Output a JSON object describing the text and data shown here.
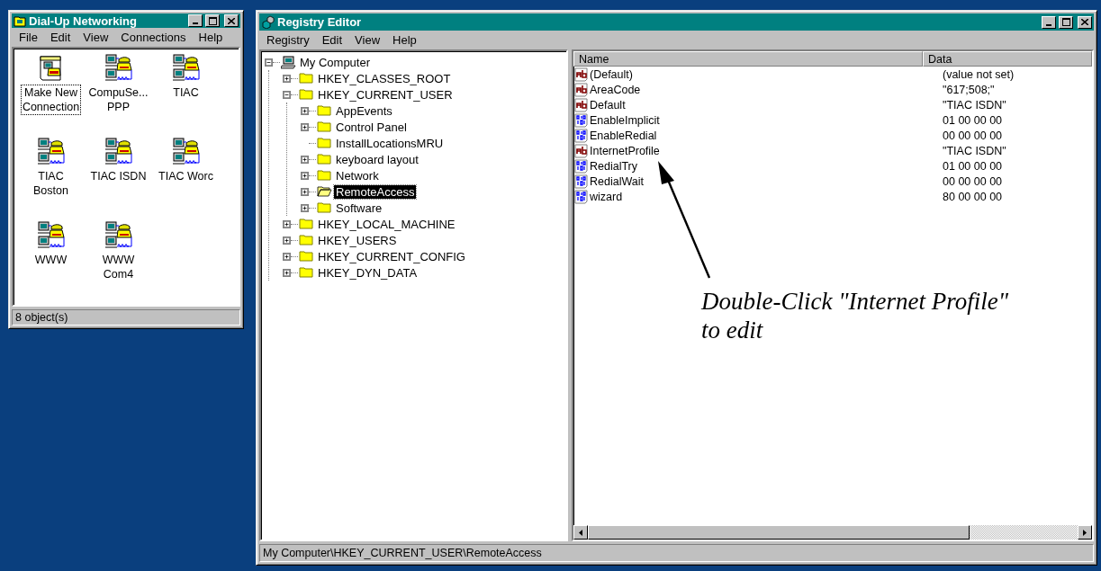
{
  "dialup_window": {
    "title": "Dial-Up Networking",
    "menu": [
      "File",
      "Edit",
      "View",
      "Connections",
      "Help"
    ],
    "icons": [
      {
        "kind": "new",
        "label_lines": [
          "Make New",
          "Connection"
        ],
        "focused": true
      },
      {
        "kind": "connection",
        "label_lines": [
          "CompuSe...",
          "PPP"
        ],
        "focused": false
      },
      {
        "kind": "connection",
        "label_lines": [
          "TIAC"
        ],
        "focused": false
      },
      {
        "kind": "connection",
        "label_lines": [
          "TIAC",
          "Boston"
        ],
        "focused": false
      },
      {
        "kind": "connection",
        "label_lines": [
          "TIAC ISDN"
        ],
        "focused": false
      },
      {
        "kind": "connection",
        "label_lines": [
          "TIAC Worc"
        ],
        "focused": false
      },
      {
        "kind": "connection",
        "label_lines": [
          "WWW"
        ],
        "focused": false
      },
      {
        "kind": "connection",
        "label_lines": [
          "WWW",
          "Com4"
        ],
        "focused": false
      }
    ],
    "status": "8 object(s)"
  },
  "registry_window": {
    "title": "Registry Editor",
    "menu": [
      "Registry",
      "Edit",
      "View",
      "Help"
    ],
    "tree": {
      "label": "My Computer",
      "kind": "computer",
      "expanded": true,
      "has_subkeys": true,
      "selected": false,
      "children": [
        {
          "label": "HKEY_CLASSES_ROOT",
          "expanded": false,
          "has_subkeys": true,
          "selected": false
        },
        {
          "label": "HKEY_CURRENT_USER",
          "expanded": true,
          "has_subkeys": true,
          "selected": false,
          "children": [
            {
              "label": "AppEvents",
              "expanded": false,
              "has_subkeys": true,
              "selected": false
            },
            {
              "label": "Control Panel",
              "expanded": false,
              "has_subkeys": true,
              "selected": false
            },
            {
              "label": "InstallLocationsMRU",
              "expanded": false,
              "has_subkeys": false,
              "selected": false
            },
            {
              "label": "keyboard layout",
              "expanded": false,
              "has_subkeys": true,
              "selected": false
            },
            {
              "label": "Network",
              "expanded": false,
              "has_subkeys": true,
              "selected": false
            },
            {
              "label": "RemoteAccess",
              "expanded": false,
              "has_subkeys": true,
              "selected": true
            },
            {
              "label": "Software",
              "expanded": false,
              "has_subkeys": true,
              "selected": false
            }
          ]
        },
        {
          "label": "HKEY_LOCAL_MACHINE",
          "expanded": false,
          "has_subkeys": true,
          "selected": false
        },
        {
          "label": "HKEY_USERS",
          "expanded": false,
          "has_subkeys": true,
          "selected": false
        },
        {
          "label": "HKEY_CURRENT_CONFIG",
          "expanded": false,
          "has_subkeys": true,
          "selected": false
        },
        {
          "label": "HKEY_DYN_DATA",
          "expanded": false,
          "has_subkeys": true,
          "selected": false
        }
      ]
    },
    "columns": [
      "Name",
      "Data"
    ],
    "values": [
      {
        "kind": "string",
        "name": "(Default)",
        "data": "(value not set)"
      },
      {
        "kind": "string",
        "name": "AreaCode",
        "data": "\"617;508;\""
      },
      {
        "kind": "string",
        "name": "Default",
        "data": "\"TIAC ISDN\""
      },
      {
        "kind": "binary",
        "name": "EnableImplicit",
        "data": "01 00 00 00"
      },
      {
        "kind": "binary",
        "name": "EnableRedial",
        "data": "00 00 00 00"
      },
      {
        "kind": "string",
        "name": "InternetProfile",
        "data": "\"TIAC ISDN\""
      },
      {
        "kind": "binary",
        "name": "RedialTry",
        "data": "01 00 00 00"
      },
      {
        "kind": "binary",
        "name": "RedialWait",
        "data": "00 00 00 00"
      },
      {
        "kind": "binary",
        "name": "wizard",
        "data": "80 00 00 00"
      }
    ],
    "annotation": {
      "lines": [
        "Double-Click \"Internet Profile\"",
        "to edit"
      ]
    },
    "status": "My Computer\\HKEY_CURRENT_USER\\RemoteAccess"
  }
}
